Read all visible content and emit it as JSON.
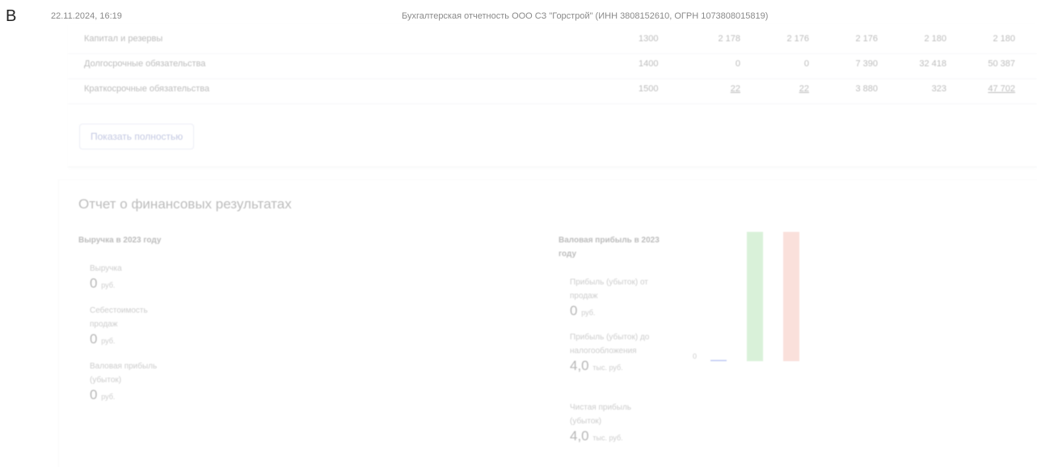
{
  "marker": "B",
  "print_header": {
    "datetime": "22.11.2024, 16:19",
    "title": "Бухгалтерская отчетность ООО СЗ \"Горстрой\" (ИНН 3808152610, ОГРН 1073808015819)"
  },
  "balance_rows": [
    {
      "name": "Капитал и резервы",
      "code": "1300",
      "values": [
        "2 178",
        "2 176",
        "2 176",
        "2 180",
        "2 180"
      ],
      "underlined": [
        false,
        false,
        false,
        false,
        false
      ]
    },
    {
      "name": "Долгосрочные обязательства",
      "code": "1400",
      "values": [
        "0",
        "0",
        "7 390",
        "32 418",
        "50 387"
      ],
      "underlined": [
        false,
        false,
        false,
        false,
        false
      ]
    },
    {
      "name": "Краткосрочные обязательства",
      "code": "1500",
      "values": [
        "22",
        "22",
        "3 880",
        "323",
        "47 702"
      ],
      "underlined": [
        true,
        true,
        false,
        false,
        true
      ]
    }
  ],
  "show_full_button": "Показать полностью",
  "financial_results": {
    "section_title": "Отчет о финансовых результатах",
    "revenue_heading": "Выручка в 2023 году",
    "revenue_metrics": [
      {
        "label": "Выручка",
        "value": "0",
        "unit": "руб."
      },
      {
        "label": "Себестоимость продаж",
        "value": "0",
        "unit": "руб."
      },
      {
        "label": "Валовая прибыль (убыток)",
        "value": "0",
        "unit": "руб."
      }
    ],
    "profit_heading": "Валовая прибыль в 2023 году",
    "profit_metrics": [
      {
        "label": "Прибыль (убыток) от продаж",
        "value": "0",
        "unit": "руб."
      },
      {
        "label": "Прибыль (убыток) до налогообложения",
        "value": "4,0",
        "unit": "тыс. руб."
      },
      {
        "label": "Чистая прибыль (убыток)",
        "value": "4,0",
        "unit": "тыс. руб."
      }
    ]
  },
  "chart_data": {
    "type": "bar",
    "categories": [
      "",
      "",
      ""
    ],
    "values": [
      0,
      4.0,
      4.0
    ],
    "colors": [
      "#3b5bdb",
      "#8bd48b",
      "#f0a090"
    ],
    "y_tick_labels": [
      "0"
    ]
  }
}
